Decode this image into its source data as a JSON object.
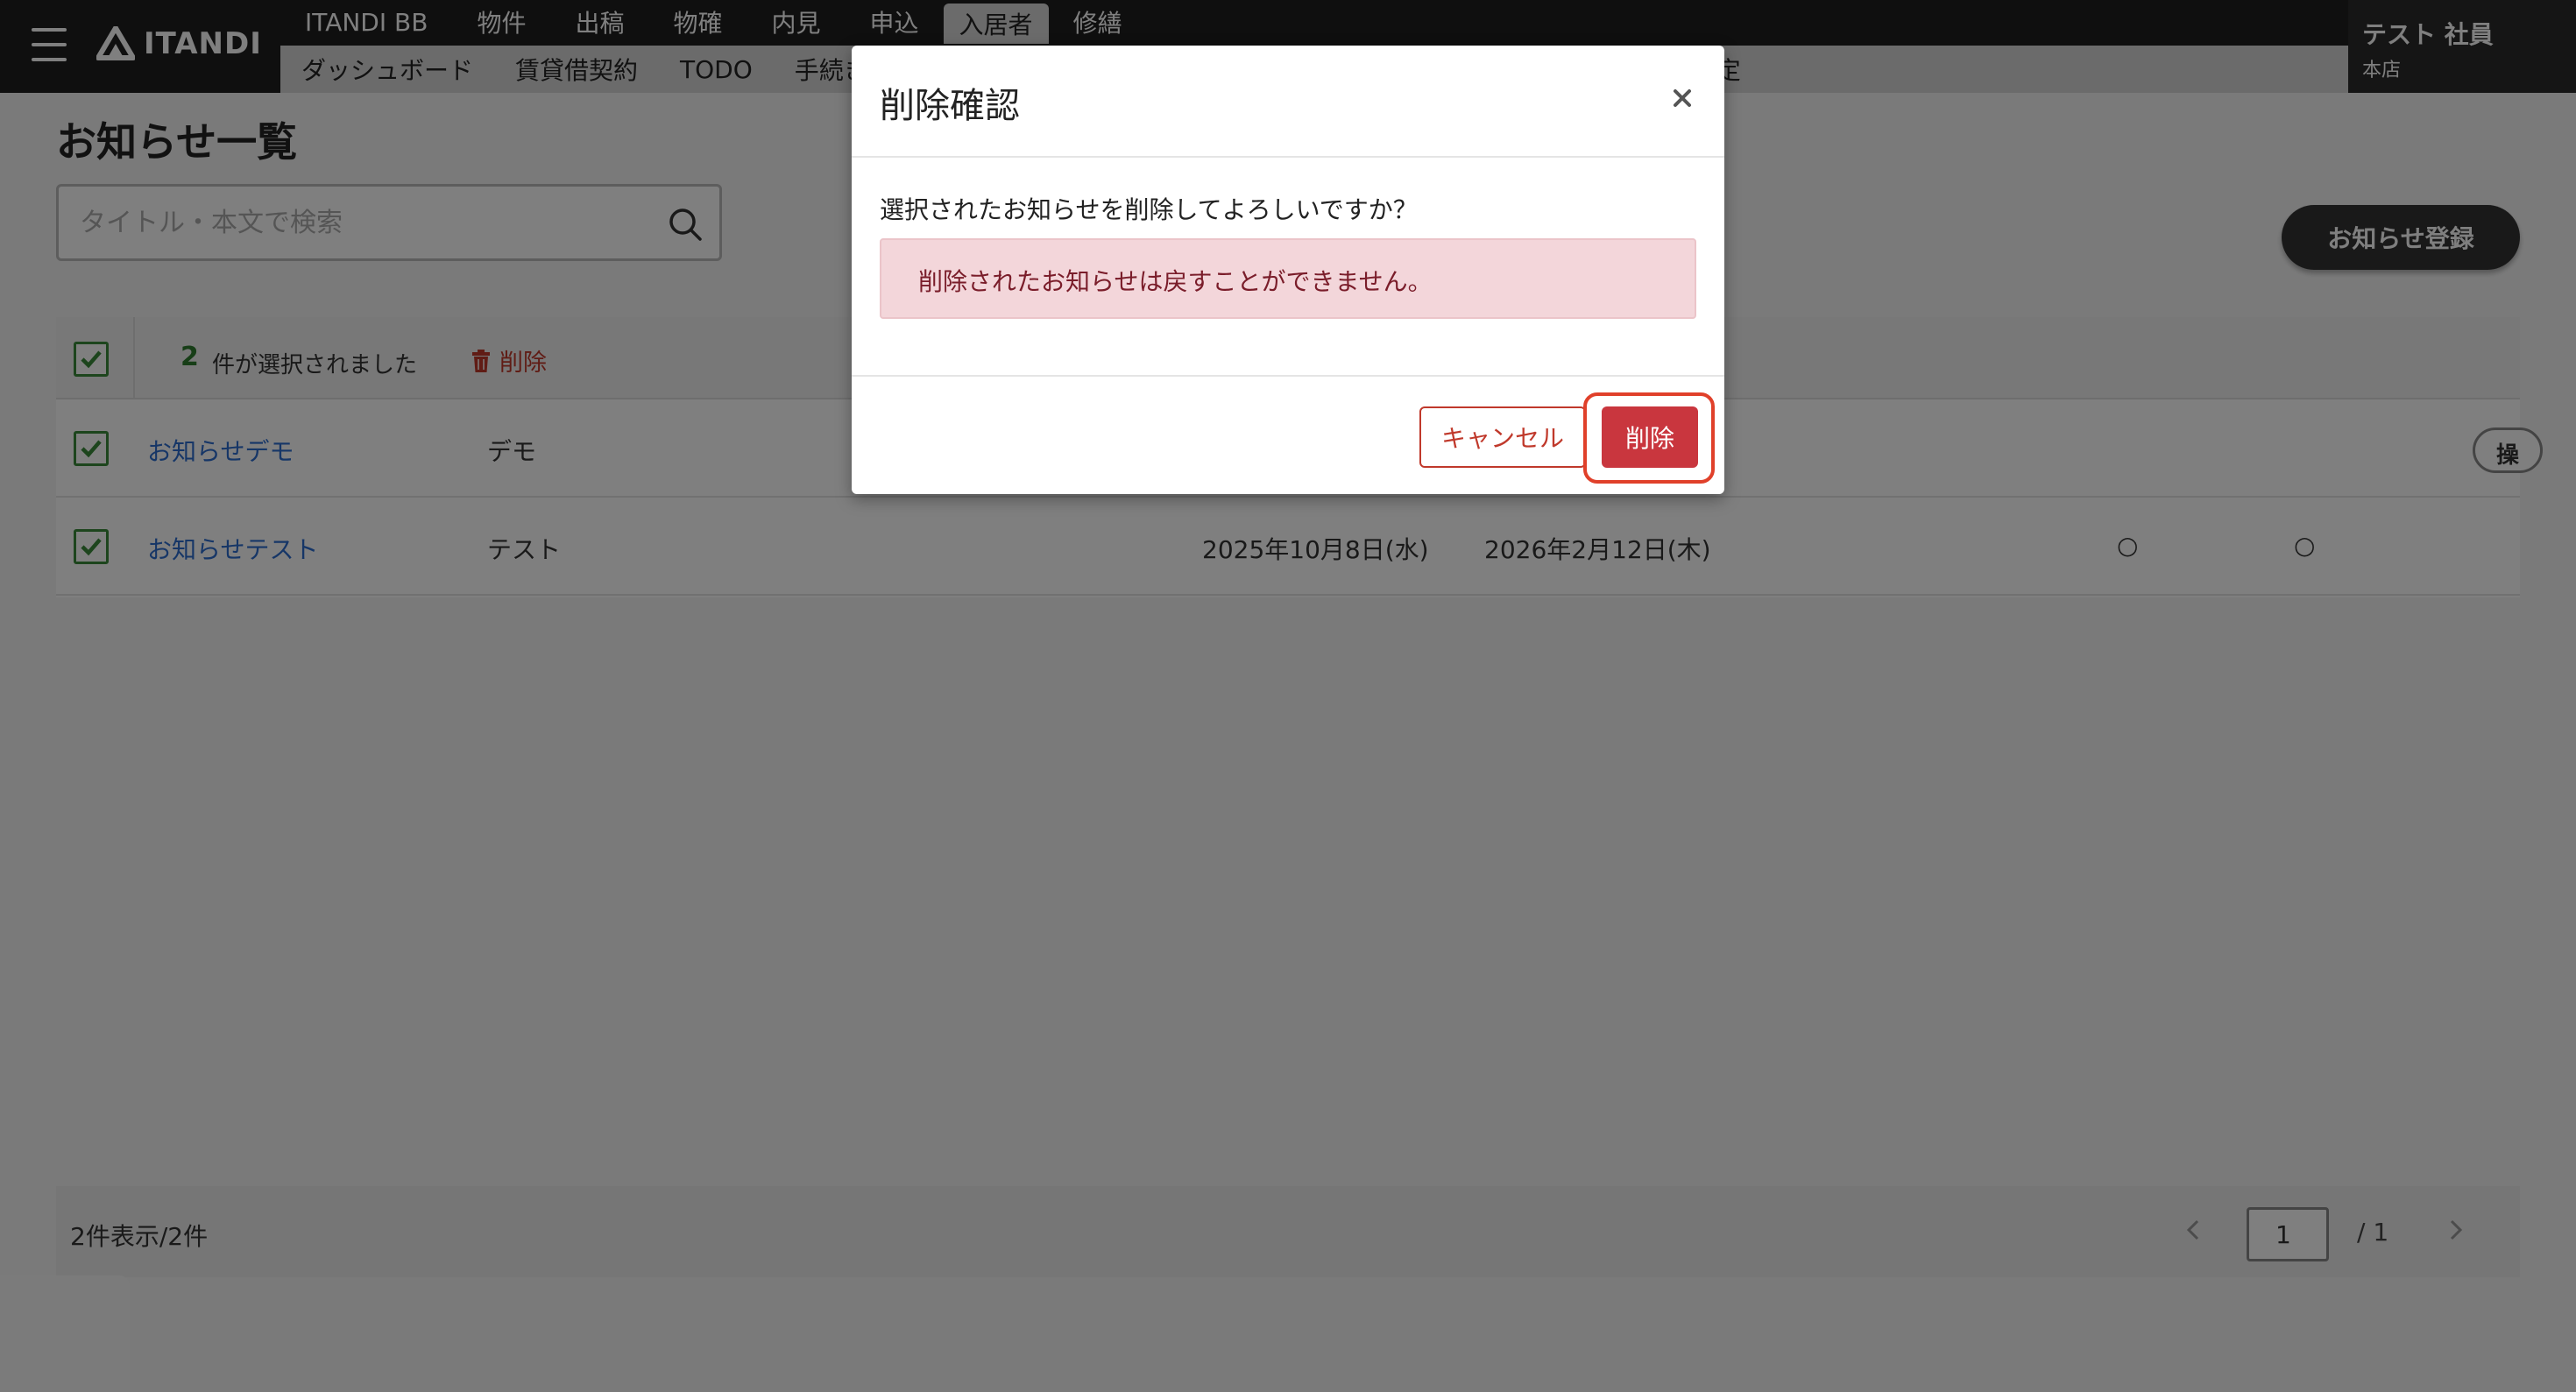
{
  "header": {
    "logo_text": "ITANDI",
    "nav_primary": [
      "ITANDI BB",
      "物件",
      "出稿",
      "物確",
      "内見",
      "申込",
      "入居者",
      "修繕"
    ],
    "nav_primary_active": "入居者",
    "nav_secondary": [
      "ダッシュボード",
      "賃貸借契約",
      "TODO",
      "手続き",
      "",
      "",
      "",
      "",
      "定"
    ],
    "user_name": "テスト 社員",
    "user_branch": "本店"
  },
  "page": {
    "title": "お知らせ一覧",
    "search_placeholder": "タイトル・本文で検索",
    "register_button": "お知らせ登録"
  },
  "selection": {
    "count": "2",
    "text": "件が選択されました",
    "delete_label": "削除"
  },
  "rows": [
    {
      "title": "お知らせデモ",
      "body": "デモ",
      "start": "",
      "end": "",
      "ops": "操"
    },
    {
      "title": "お知らせテスト",
      "body": "テスト",
      "start": "2025年10月8日(水)",
      "end": "2026年2月12日(木)",
      "mark1": "○",
      "mark2": "○"
    }
  ],
  "footer": {
    "count_text": "2件表示/2件",
    "page_current": "1",
    "page_total": "/ 1"
  },
  "modal": {
    "title": "削除確認",
    "message": "選択されたお知らせを削除してよろしいですか？",
    "alert": "削除されたお知らせは戻すことができません。",
    "cancel_label": "キャンセル",
    "delete_label": "削除"
  },
  "colors": {
    "accent_danger": "#c9363e",
    "link": "#2d6dcf",
    "check_green": "#3a8a3a"
  }
}
